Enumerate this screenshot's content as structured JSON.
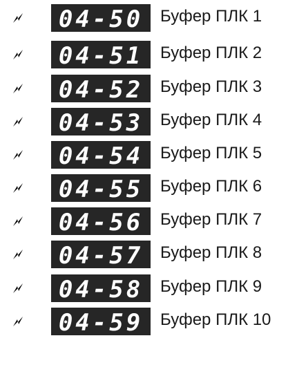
{
  "parameters": [
    {
      "code": "04-50",
      "label": "Буфер ПЛК 1"
    },
    {
      "code": "04-51",
      "label": "Буфер ПЛК 2"
    },
    {
      "code": "04-52",
      "label": "Буфер ПЛК 3"
    },
    {
      "code": "04-53",
      "label": "Буфер ПЛК 4"
    },
    {
      "code": "04-54",
      "label": "Буфер ПЛК 5"
    },
    {
      "code": "04-55",
      "label": "Буфер ПЛК 6"
    },
    {
      "code": "04-56",
      "label": "Буфер ПЛК 7"
    },
    {
      "code": "04-57",
      "label": "Буфер ПЛК 8"
    },
    {
      "code": "04-58",
      "label": "Буфер ПЛК 9"
    },
    {
      "code": "04-59",
      "label": "Буфер ПЛК 10"
    }
  ],
  "icons": {
    "row_marker": "run-mode-icon"
  },
  "colors": {
    "display_background": "#262626",
    "display_text": "#ffffff",
    "label_text": "#1a1a1a"
  }
}
